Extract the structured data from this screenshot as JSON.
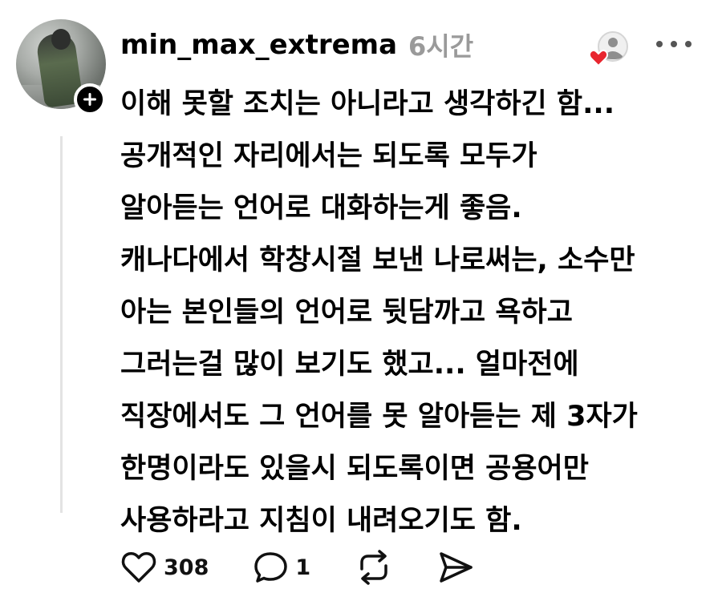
{
  "post": {
    "username": "min_max_extrema",
    "time": "6시간",
    "lines": [
      "이해 못할 조치는 아니라고 생각하긴 함...",
      "공개적인 자리에서는 되도록 모두가",
      "알아듣는 언어로 대화하는게 좋음.",
      "캐나다에서 학창시절 보낸 나로써는, 소수만",
      "아는 본인들의 언어로 뒷담까고 욕하고",
      "그러는걸 많이 보기도 했고... 얼마전에",
      "직장에서도 그 언어를 못 알아듣는 제 3자가",
      "한명이라도 있을시 되도록이면 공용어만",
      "사용하라고 지침이 내려오기도 함."
    ],
    "likes": "308",
    "replies": "1"
  },
  "icons": {
    "follow": "plus-icon",
    "reactor": "heart-avatar-icon",
    "more": "more-horizontal-icon",
    "like": "heart-outline-icon",
    "reply": "comment-icon",
    "repost": "repost-icon",
    "share": "send-icon"
  },
  "colors": {
    "heart_red": "#e8262f",
    "muted": "#9a9a9a",
    "thread_line": "#e3e3e3"
  }
}
